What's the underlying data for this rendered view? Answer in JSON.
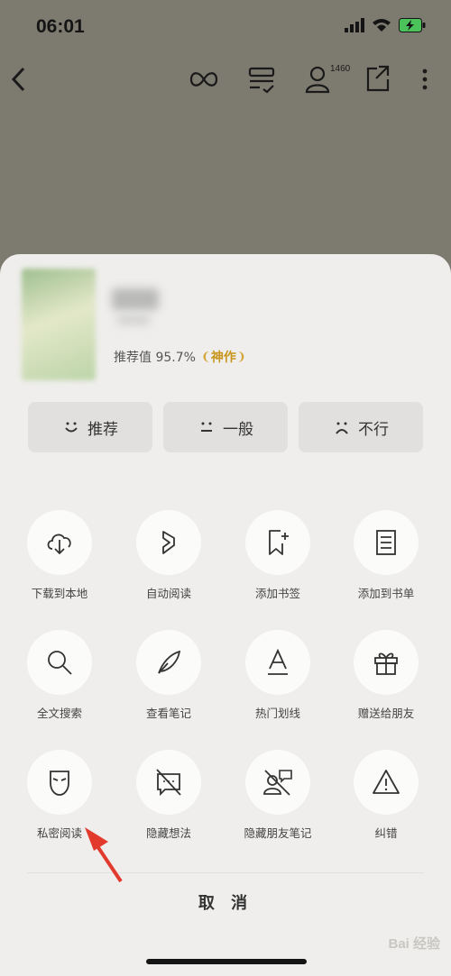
{
  "status": {
    "time": "06:01"
  },
  "topbar": {
    "reader_count": "1460"
  },
  "book": {
    "rec_label": "推荐值 95.7%",
    "badge": "神作"
  },
  "rating": [
    {
      "label": "推荐"
    },
    {
      "label": "一般"
    },
    {
      "label": "不行"
    }
  ],
  "actions": [
    {
      "label": "下载到本地",
      "icon": "cloud-download-icon"
    },
    {
      "label": "自动阅读",
      "icon": "auto-read-icon"
    },
    {
      "label": "添加书签",
      "icon": "bookmark-add-icon"
    },
    {
      "label": "添加到书单",
      "icon": "booklist-icon"
    },
    {
      "label": "全文搜索",
      "icon": "search-icon"
    },
    {
      "label": "查看笔记",
      "icon": "feather-icon"
    },
    {
      "label": "热门划线",
      "icon": "underline-a-icon"
    },
    {
      "label": "赠送给朋友",
      "icon": "gift-icon"
    },
    {
      "label": "私密阅读",
      "icon": "mask-icon"
    },
    {
      "label": "隐藏想法",
      "icon": "hide-thought-icon"
    },
    {
      "label": "隐藏朋友笔记",
      "icon": "hide-friends-icon"
    },
    {
      "label": "纠错",
      "icon": "warning-icon"
    }
  ],
  "cancel_label": "取 消",
  "watermark": "Bai 经验",
  "colors": {
    "overlay": "#7d7b70",
    "sheet": "#efeeec",
    "badge": "#c8961e",
    "arrow": "#e23a2d"
  }
}
